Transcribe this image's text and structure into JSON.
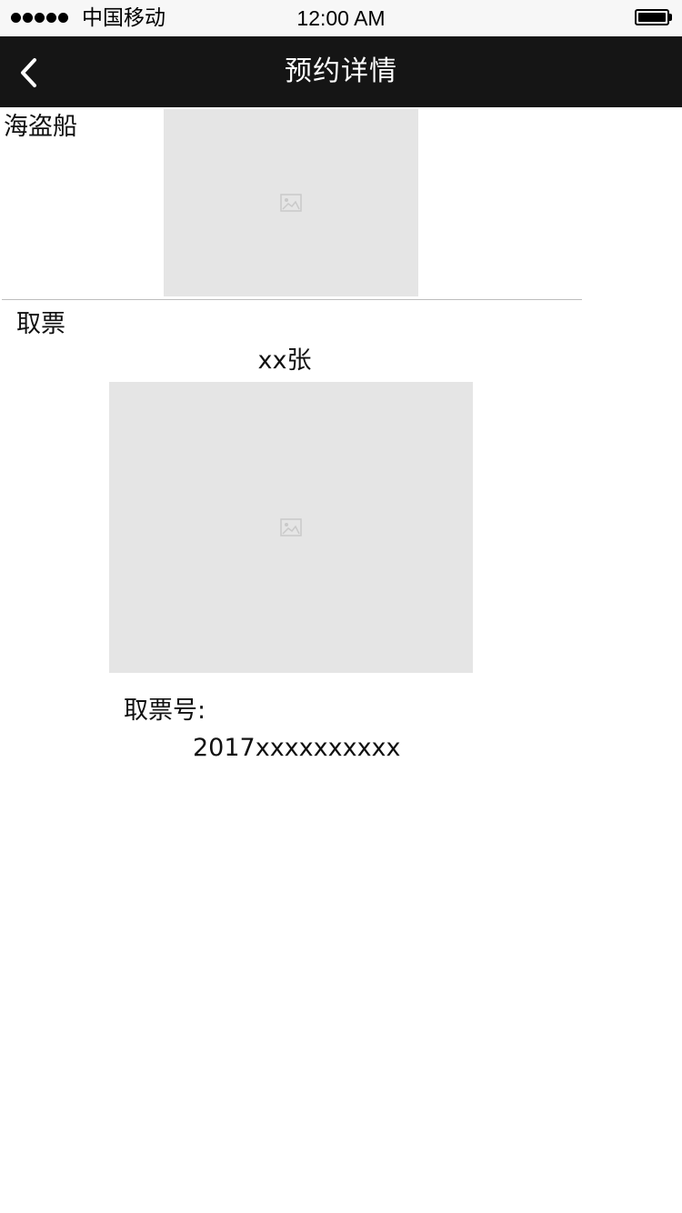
{
  "status_bar": {
    "carrier": "中国移动",
    "time": "12:00 AM",
    "battery_level": 1.0
  },
  "nav": {
    "back_icon": "chevron-left-icon",
    "title": "预约详情"
  },
  "venue": {
    "name": "海盗船",
    "image_icon": "image-placeholder-icon"
  },
  "ticket_pickup": {
    "section_label": "取票",
    "count": "xx张",
    "qr_image_icon": "image-placeholder-icon",
    "number_label": "取票号:",
    "number_value": "2017xxxxxxxxxx"
  },
  "colors": {
    "nav_background": "#151515",
    "status_background": "#f7f7f7",
    "placeholder": "#e5e5e5",
    "divider": "#bdbdbd"
  }
}
